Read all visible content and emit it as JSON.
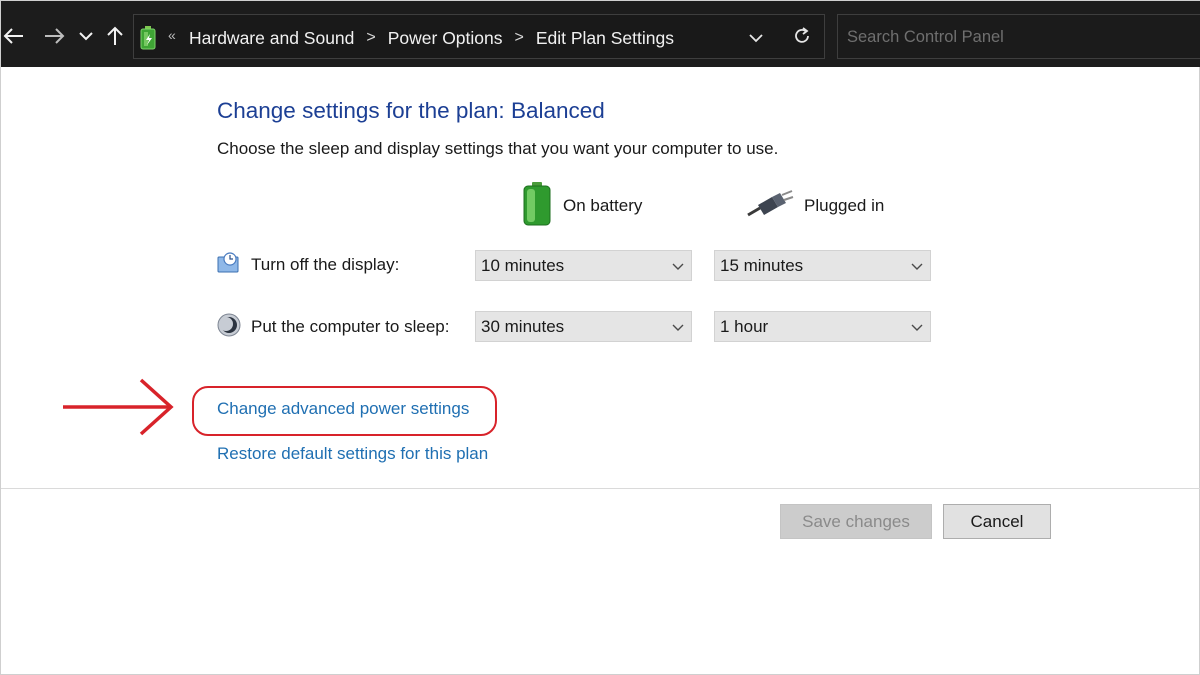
{
  "nav": {
    "back_icon": "back-arrow-icon",
    "forward_icon": "forward-arrow-icon",
    "recent_icon": "chevron-down-icon",
    "up_icon": "up-arrow-icon"
  },
  "address_bar": {
    "overflow_glyph": "«",
    "breadcrumbs": [
      "Hardware and Sound",
      "Power Options",
      "Edit Plan Settings"
    ],
    "separator": ">"
  },
  "search": {
    "placeholder": "Search Control Panel",
    "value": ""
  },
  "main": {
    "title": "Change settings for the plan: Balanced",
    "subtitle": "Choose the sleep and display settings that you want your computer to use.",
    "columns": {
      "battery": "On battery",
      "plugged": "Plugged in"
    },
    "rows": {
      "display": {
        "label": "Turn off the display:",
        "battery_value": "10 minutes",
        "plugged_value": "15 minutes"
      },
      "sleep": {
        "label": "Put the computer to sleep:",
        "battery_value": "30 minutes",
        "plugged_value": "1 hour"
      }
    },
    "links": {
      "advanced": "Change advanced power settings",
      "restore": "Restore default settings for this plan"
    }
  },
  "buttons": {
    "save": "Save changes",
    "cancel": "Cancel"
  },
  "colors": {
    "title_blue": "#1c3f94",
    "link_blue": "#1f6fb2",
    "annotation_red": "#d8232a",
    "topbar": "#1c1c1c"
  }
}
